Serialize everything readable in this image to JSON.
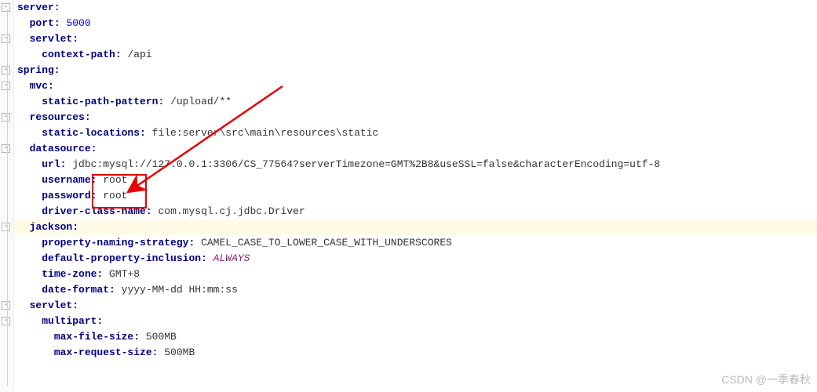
{
  "yaml": {
    "server": {
      "key": "server:",
      "port_key": "port:",
      "port_val": "5000",
      "servlet": {
        "key": "servlet:",
        "context_path_key": "context-path:",
        "context_path_val": "/api"
      }
    },
    "spring": {
      "key": "spring:",
      "mvc": {
        "key": "mvc:",
        "static_path_pattern_key": "static-path-pattern:",
        "static_path_pattern_val": "/upload/**"
      },
      "resources": {
        "key": "resources:",
        "static_locations_key": "static-locations:",
        "static_locations_val": "file:server\\src\\main\\resources\\static"
      },
      "datasource": {
        "key": "datasource:",
        "url_key": "url:",
        "url_val": "jdbc:mysql://127.0.0.1:3306/CS_77564?serverTimezone=GMT%2B8&useSSL=false&characterEncoding=utf-8",
        "username_key": "username:",
        "username_val": "root",
        "password_key": "password:",
        "password_val": "root",
        "driver_key": "driver-class-name:",
        "driver_val": "com.mysql.cj.jdbc.Driver"
      },
      "jackson": {
        "key": "jackson:",
        "naming_key": "property-naming-strategy:",
        "naming_val": "CAMEL_CASE_TO_LOWER_CASE_WITH_UNDERSCORES",
        "inclusion_key": "default-property-inclusion:",
        "inclusion_val": "ALWAYS",
        "tz_key": "time-zone:",
        "tz_val": "GMT+8",
        "df_key": "date-format:",
        "df_val": "yyyy-MM-dd HH:mm:ss"
      },
      "servlet": {
        "key": "servlet:",
        "multipart": {
          "key": "multipart:",
          "max_file_key": "max-file-size:",
          "max_file_val": "500MB",
          "max_req_key": "max-request-size:",
          "max_req_val": "500MB"
        }
      }
    }
  },
  "fold_marks": [
    "-",
    "-",
    "-",
    "-",
    "-",
    "-",
    "-",
    "-",
    "-",
    "-",
    "-"
  ],
  "watermark": "CSDN @一季春秋"
}
